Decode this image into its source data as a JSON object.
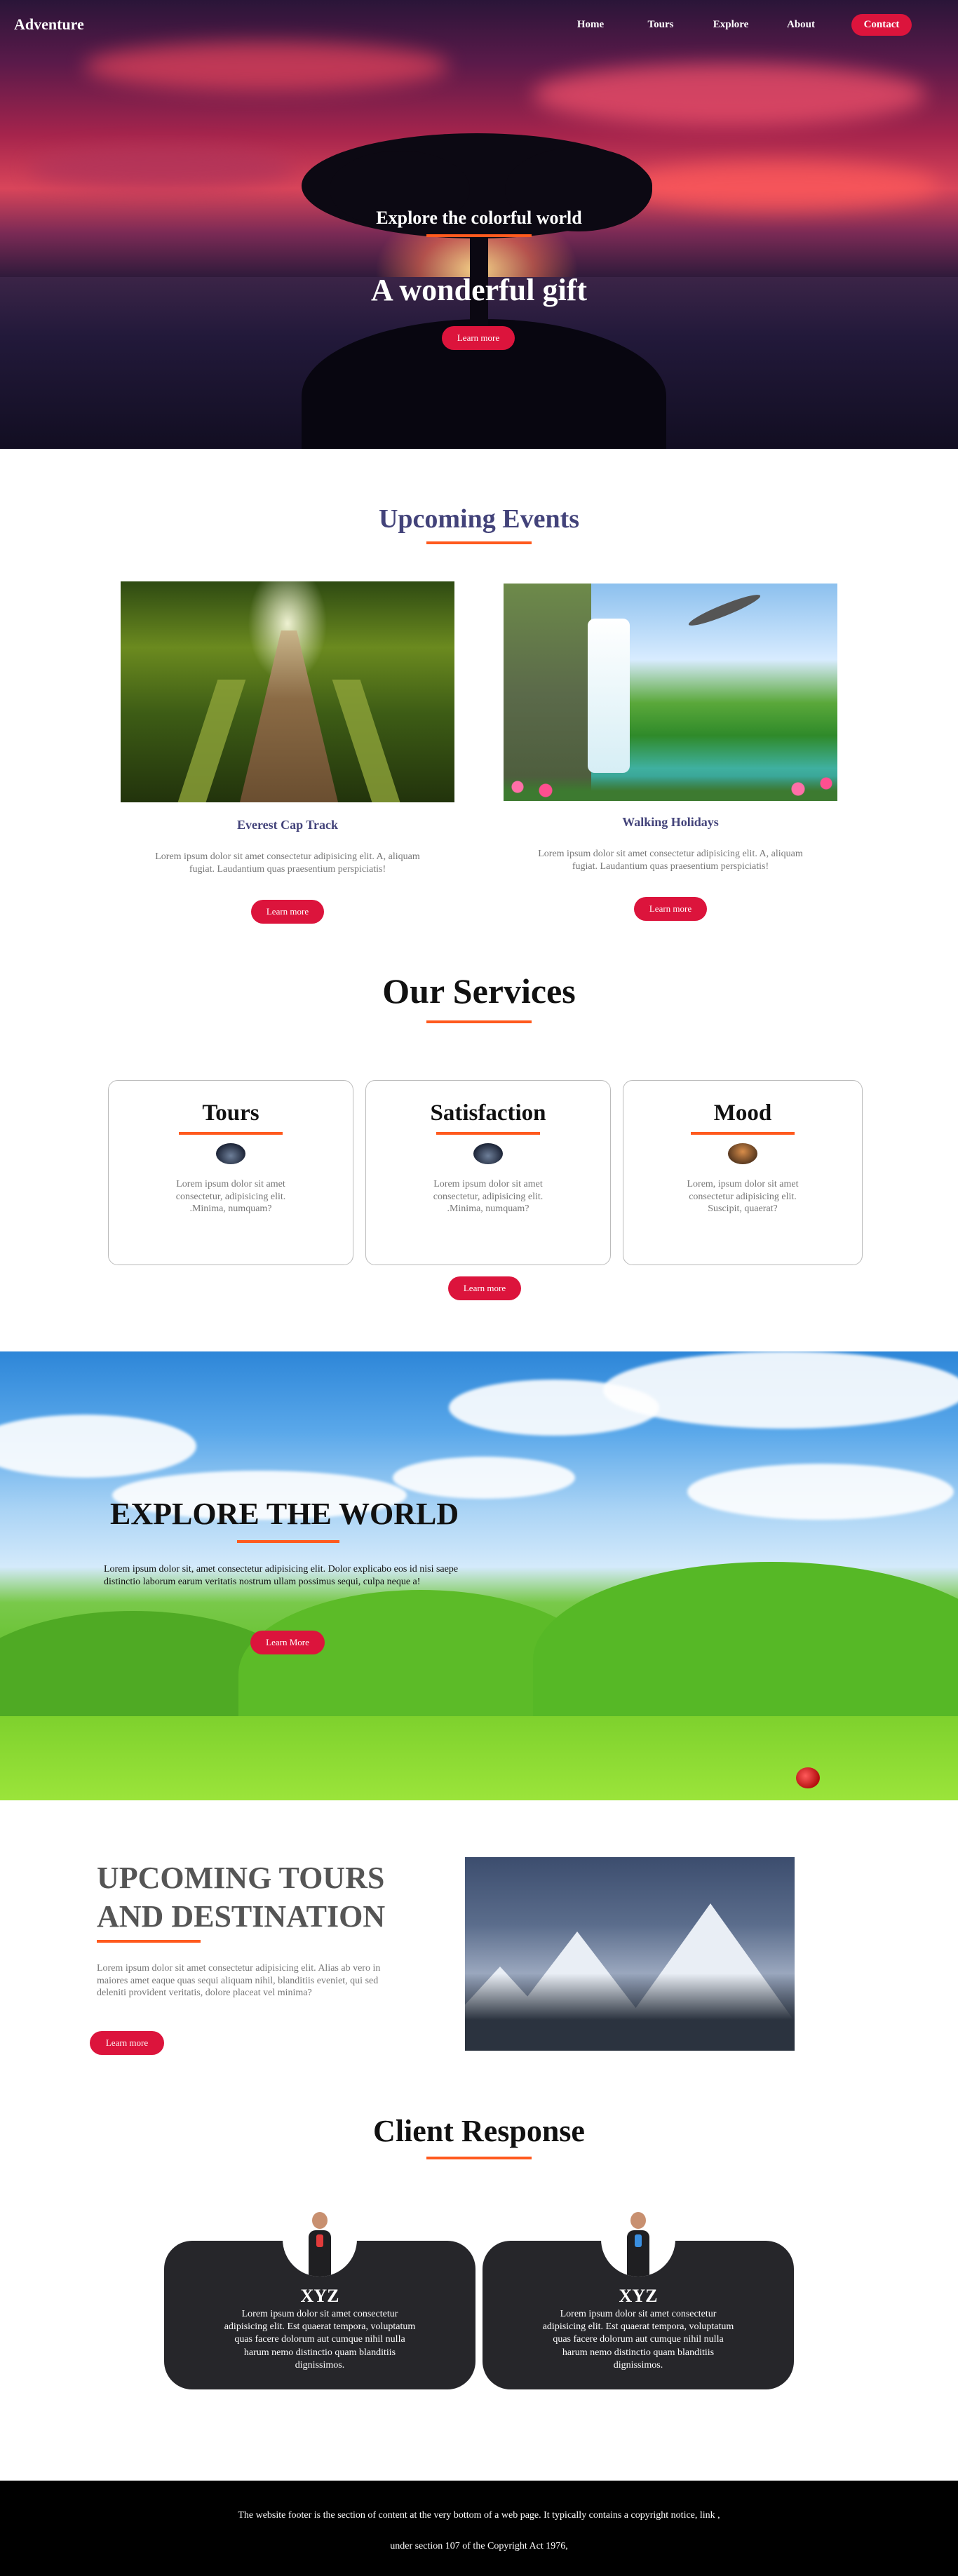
{
  "nav": {
    "logo": "Adventure",
    "links": [
      "Home",
      "Tours",
      "Explore",
      "About"
    ],
    "contact": "Contact"
  },
  "hero": {
    "subtitle": "Explore the colorful world",
    "title": "A wonderful gift",
    "button": "Learn more"
  },
  "events": {
    "title": "Upcoming Events",
    "cards": [
      {
        "name": "Everest Cap Track",
        "desc": "Lorem ipsum dolor sit amet consectetur adipisicing elit. A, aliquam fugiat. Laudantium quas praesentium perspiciatis!",
        "button": "Learn more"
      },
      {
        "name": "Walking Holidays",
        "desc": "Lorem ipsum dolor sit amet consectetur adipisicing elit. A, aliquam fugiat. Laudantium quas praesentium perspiciatis!",
        "button": "Learn more"
      }
    ]
  },
  "services": {
    "title": "Our Services",
    "cards": [
      {
        "name": "Tours",
        "desc": "Lorem ipsum dolor sit amet consectetur, adipisicing elit. .Minima, numquam?"
      },
      {
        "name": "Satisfaction",
        "desc": "Lorem ipsum dolor sit amet consectetur, adipisicing elit. .Minima, numquam?"
      },
      {
        "name": "Mood",
        "desc": "Lorem, ipsum dolor sit amet consectetur adipisicing elit. Suscipit, quaerat?"
      }
    ],
    "button": "Learn more"
  },
  "explore": {
    "title": "EXPLORE THE WORLD",
    "desc": "Lorem ipsum dolor sit, amet consectetur adipisicing elit. Dolor explicabo eos id nisi saepe distinctio laborum earum veritatis nostrum ullam possimus sequi, culpa neque a!",
    "button": "Learn More"
  },
  "tours": {
    "title": "UPCOMING TOURS AND DESTINATION",
    "desc": "Lorem ipsum dolor sit amet consectetur adipisicing elit. Alias ab vero in maiores amet eaque quas sequi aliquam nihil, blanditiis eveniet, qui sed deleniti provident veritatis, dolore placeat vel minima?",
    "button": "Learn more"
  },
  "clients": {
    "title": "Client Response",
    "cards": [
      {
        "name": "XYZ",
        "text": "Lorem ipsum dolor sit amet consectetur adipisicing elit. Est quaerat tempora, voluptatum quas facere dolorum aut cumque nihil nulla harum nemo distinctio quam blanditiis dignissimos."
      },
      {
        "name": "XYZ",
        "text": "Lorem ipsum dolor sit amet consectetur adipisicing elit. Est quaerat tempora, voluptatum quas facere dolorum aut cumque nihil nulla harum nemo distinctio quam blanditiis dignissimos."
      }
    ]
  },
  "footer": {
    "line1": "The website footer is the section of content at the very bottom of a web page. It typically contains a copyright notice, link ,",
    "line2": "under section 107 of the Copyright Act 1976,"
  },
  "colors": {
    "accent": "#dc143c",
    "underline": "#ff5a1e",
    "heading_purple": "#43437a",
    "card_dark": "#26262a"
  }
}
